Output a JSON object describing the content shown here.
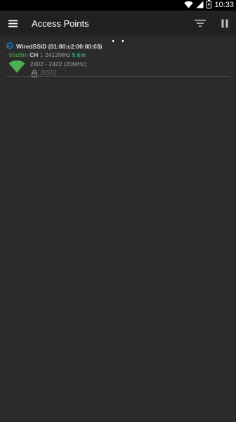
{
  "status_bar": {
    "time": "10:33"
  },
  "toolbar": {
    "title": "Access Points",
    "menu_icon": "hamburger-menu-icon",
    "filter_icon": "filter-icon",
    "pause_icon": "pause-icon"
  },
  "access_points": [
    {
      "ssid_bssid": "WiredSSID (01:80:c2:00:00:03)",
      "level": "-55dBm",
      "channel_label": "CH",
      "channel": "1",
      "frequency": "2412MHz",
      "distance": "5.6m",
      "frequency_range": "2402 - 2422 (20MHz)",
      "capabilities": "[ESS]",
      "connection_icon": "connected-face-icon",
      "signal_icon": "wifi-strength-icon",
      "security_icon": "lock-icon"
    }
  ],
  "colors": {
    "level": "#4caf50",
    "channel": "#2196f3",
    "distance": "#26a69a",
    "capabilities": "#607d8b",
    "toolbar": "#212121",
    "background": "#2b2b2b"
  }
}
